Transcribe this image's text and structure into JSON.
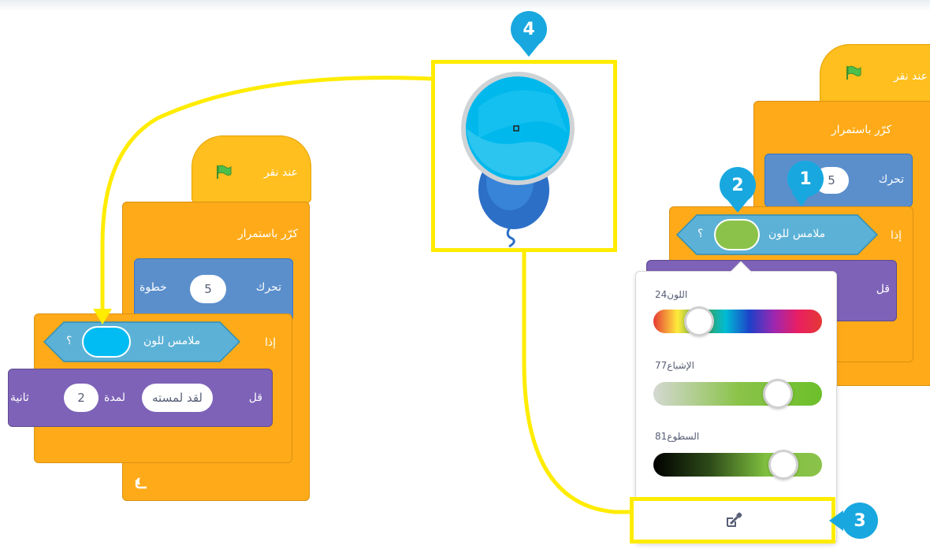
{
  "labels": {
    "when_flag_clicked": "عند نقر",
    "forever": "كرّر باستمرار",
    "move": "تحرك",
    "steps": "خطوة",
    "if": "إذا",
    "touching_color": "ملامس للون",
    "question": "؟",
    "say": "قل",
    "say_text": "لقد لمسته",
    "for_duration": "لمدة",
    "seconds": "ثانية"
  },
  "values": {
    "move_steps": "5",
    "say_seconds": "2",
    "right_move_steps": "5"
  },
  "color_picker": {
    "hue_label": "اللون",
    "hue_value": "24",
    "saturation_label": "الإشباع",
    "saturation_value": "77",
    "brightness_label": "السطوع",
    "brightness_value": "81",
    "hue_level": 0.24,
    "saturation_level": 0.77,
    "brightness_level": 0.81
  },
  "badges": {
    "b1": "1",
    "b2": "2",
    "b3": "3",
    "b4": "4"
  },
  "colors": {
    "hat": "#ffbf1e",
    "control": "#ffab19",
    "motion": "#4c97ff",
    "looks": "#7e62b8",
    "sensing": "#5cb1d6",
    "highlight": "#ffec00",
    "badge": "#18a8df",
    "picked_green": "#8bc34a",
    "picked_blue": "#00bcf2"
  },
  "icons": {
    "flag": "green-flag-icon",
    "loop_arrow": "loop-arrow-icon",
    "eyedropper": "eyedropper-icon",
    "balloon": "balloon-image"
  }
}
